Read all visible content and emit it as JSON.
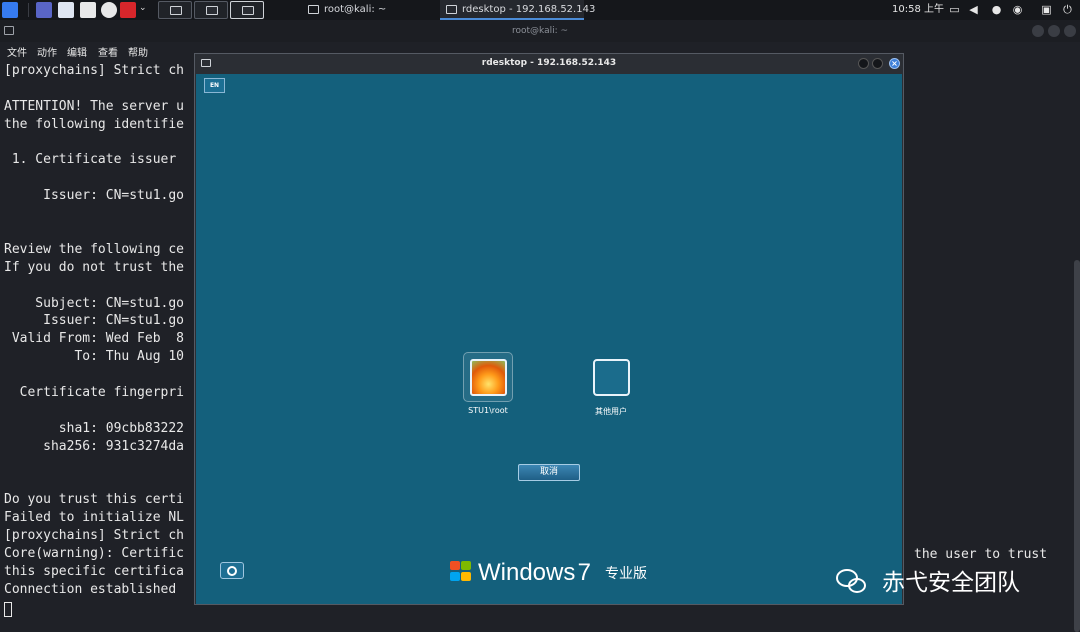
{
  "taskbar": {
    "tasks": [
      {
        "label": "root@kali: ~"
      },
      {
        "label": "rdesktop - 192.168.52.143"
      }
    ],
    "clock": "10:58 上午"
  },
  "terminal_window": {
    "title": "root@kali: ~",
    "menu": [
      "文件",
      "动作",
      "编辑",
      "查看",
      "帮助"
    ],
    "lines": [
      "[proxychains] Strict ch",
      "",
      "ATTENTION! The server u",
      "the following identifie",
      "",
      " 1. Certificate issuer",
      "",
      "     Issuer: CN=stu1.go",
      "",
      "",
      "Review the following ce",
      "If you do not trust the",
      "",
      "    Subject: CN=stu1.go",
      "     Issuer: CN=stu1.go",
      " Valid From: Wed Feb  8",
      "         To: Thu Aug 10",
      "",
      "  Certificate fingerpri",
      "",
      "       sha1: 09cbb83222",
      "     sha256: 931c3274da",
      "",
      "",
      "Do you trust this certi",
      "Failed to initialize NL",
      "[proxychains] Strict ch",
      "Core(warning): Certific",
      "this specific certifica",
      "Connection established"
    ],
    "right_fragment": "the user to trust"
  },
  "rdp_window": {
    "title": "rdesktop - 192.168.52.143",
    "language_indicator": "EN",
    "users": [
      {
        "name": "STU1\\root"
      },
      {
        "name": "其他用户"
      }
    ],
    "cancel_label": "取消",
    "brand_word": "Windows",
    "brand_version": "7",
    "brand_edition": "专业版"
  },
  "watermark": "赤弋安全团队"
}
